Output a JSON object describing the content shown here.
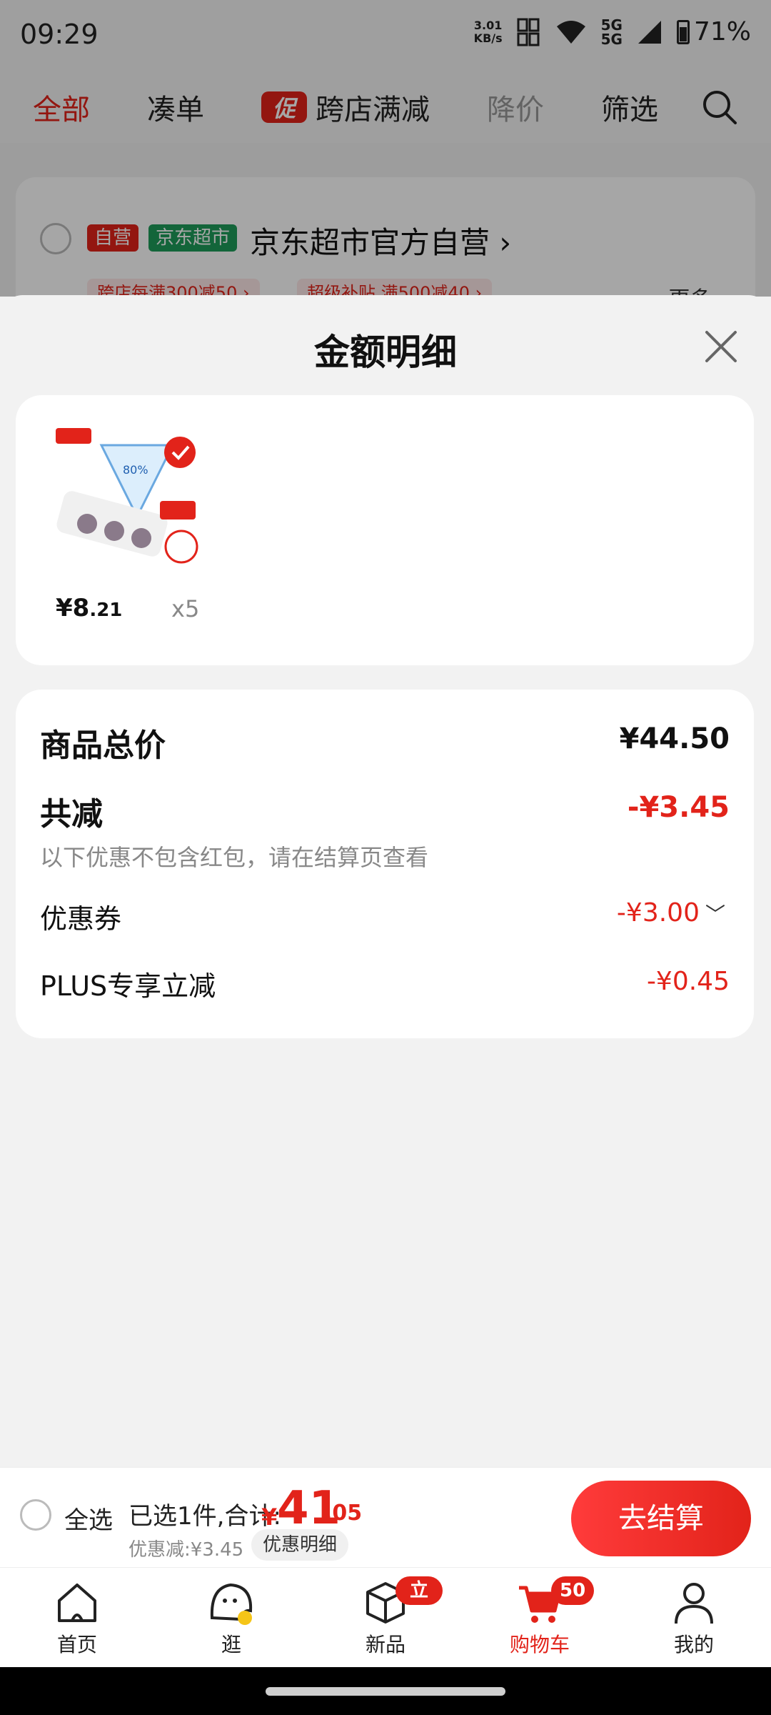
{
  "status_bar": {
    "time": "09:29",
    "net_speed": "3.01\nKB/s",
    "network": "5G\n5G",
    "battery": "71%"
  },
  "top_tabs": {
    "all": "全部",
    "combine": "凑单",
    "promo_badge": "促",
    "cross_store": "跨店满减",
    "price_drop": "降价",
    "filter": "筛选"
  },
  "store": {
    "self_tag": "自营",
    "market_tag": "京东超市",
    "name": "京东超市官方自营 ›",
    "coupon1": "跨店每满300减50 ›",
    "coupon2": "超级补贴 满500减40 ›",
    "more": "更多 ›"
  },
  "sheet": {
    "title": "金额明细",
    "product": {
      "price_int": "¥8",
      "price_dec": ".21",
      "qty": "x5"
    },
    "summary": {
      "total_label": "商品总价",
      "total_value": "¥44.50",
      "reduce_label": "共减",
      "reduce_value": "-¥3.45",
      "reduce_note": "以下优惠不包含红包，请在结算页查看",
      "coupon_label": "优惠券",
      "coupon_value": "-¥3.00",
      "plus_label": "PLUS专享立减",
      "plus_value": "-¥0.45"
    }
  },
  "checkout": {
    "select_all": "全选",
    "selected_text": "已选1件,合计:",
    "total_yen": "¥",
    "total_int": "41",
    "total_dec": ".05",
    "discount": "优惠减:¥3.45",
    "detail_button": "优惠明细",
    "checkout_button": "去结算"
  },
  "bottom_nav": {
    "home": "首页",
    "browse": "逛",
    "new": "新品",
    "new_badge": "立冬",
    "cart": "购物车",
    "cart_badge": "50",
    "me": "我的"
  },
  "colors": {
    "accent": "#e2231a",
    "green_tag": "#1e9c5a"
  }
}
